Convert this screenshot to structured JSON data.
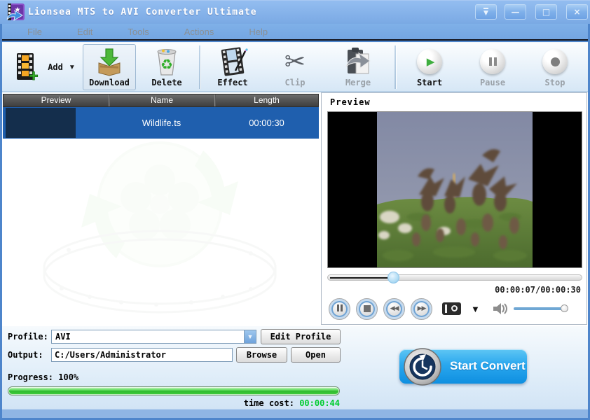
{
  "window": {
    "title": "Lionsea MTS to AVI Converter Ultimate"
  },
  "menu": {
    "items": [
      "File",
      "Edit",
      "Tools",
      "Actions",
      "Help"
    ]
  },
  "icons": {
    "rollup": "▼",
    "minimize": "—",
    "maximize": "□",
    "close": "×",
    "add_caret": "▼",
    "play": "▶",
    "rewind": "◀◀",
    "fast_forward": "▶▶",
    "dropdown_caret": "▼",
    "combo_caret": "▼",
    "recycle": "♻",
    "scissors": "✂"
  },
  "toolbar": {
    "add_label": "Add",
    "download_label": "Download",
    "delete_label": "Delete",
    "effect_label": "Effect",
    "clip_label": "Clip",
    "merge_label": "Merge",
    "start_label": "Start",
    "pause_label": "Pause",
    "stop_label": "Stop"
  },
  "filelist": {
    "columns": [
      "Preview",
      "Name",
      "Length"
    ],
    "rows": [
      {
        "name": "Wildlife.ts",
        "length": "00:00:30"
      }
    ]
  },
  "preview": {
    "title": "Preview",
    "time": "00:00:07/00:00:30",
    "seek_percent": 25,
    "volume_percent": 97
  },
  "bottom": {
    "profile_label": "Profile:",
    "profile_value": "AVI",
    "edit_profile_label": "Edit Profile",
    "output_label": "Output:",
    "output_value": "C:/Users/Administrator",
    "browse_label": "Browse",
    "open_label": "Open",
    "progress_label": "Progress: 100%",
    "progress_percent": 100,
    "time_cost_label": "time cost:",
    "time_cost_value": "00:00:44",
    "start_convert_label": "Start Convert"
  },
  "colors": {
    "selection_blue": "#1f5fae",
    "titlebar_blue": "#7fb0e8",
    "progress_green": "#3ecb3c",
    "time_value_green": "#00cc2e",
    "convert_button_blue": "#2aa7ee"
  }
}
